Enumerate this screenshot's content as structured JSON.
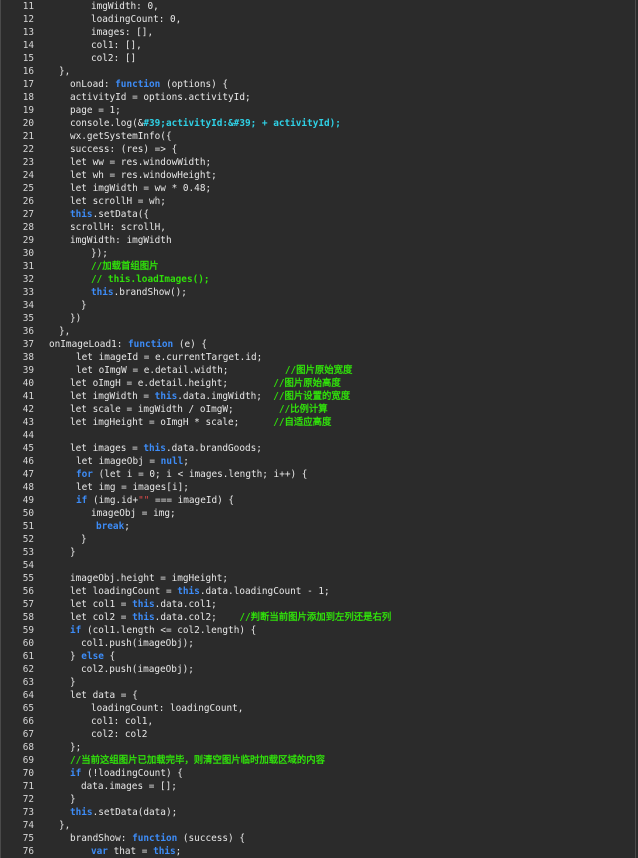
{
  "lines": [
    {
      "n": "11",
      "t": [
        [
          "imgWidth: 0,",
          ""
        ]
      ],
      "x": 90
    },
    {
      "n": "12",
      "t": [
        [
          "loadingCount: 0,",
          ""
        ]
      ],
      "x": 90
    },
    {
      "n": "13",
      "t": [
        [
          "images: [],",
          ""
        ]
      ],
      "x": 90
    },
    {
      "n": "14",
      "t": [
        [
          "col1: [],",
          ""
        ]
      ],
      "x": 90
    },
    {
      "n": "15",
      "t": [
        [
          "col2: []",
          ""
        ]
      ],
      "x": 90
    },
    {
      "n": "16",
      "t": [
        [
          "},",
          ""
        ]
      ],
      "x": 58
    },
    {
      "n": "17",
      "t": [
        [
          "onLoad: ",
          ""
        ],
        [
          "function",
          "kw"
        ],
        [
          " (options) {",
          ""
        ]
      ],
      "x": 69
    },
    {
      "n": "18",
      "t": [
        [
          "activityId = options.activityId;",
          ""
        ]
      ],
      "x": 69
    },
    {
      "n": "19",
      "t": [
        [
          "page = 1;",
          ""
        ]
      ],
      "x": 69
    },
    {
      "n": "20",
      "t": [
        [
          "console.log(&",
          ""
        ],
        [
          "#39;activityId:&#39; + activityId);",
          "lg"
        ]
      ],
      "x": 69
    },
    {
      "n": "21",
      "t": [
        [
          "wx.getSystemInfo({",
          ""
        ]
      ],
      "x": 69
    },
    {
      "n": "22",
      "t": [
        [
          "success: (res) => {",
          ""
        ]
      ],
      "x": 69
    },
    {
      "n": "23",
      "t": [
        [
          "let ww = res.windowWidth;",
          ""
        ]
      ],
      "x": 69
    },
    {
      "n": "24",
      "t": [
        [
          "let wh = res.windowHeight;",
          ""
        ]
      ],
      "x": 69
    },
    {
      "n": "25",
      "t": [
        [
          "let imgWidth = ww * 0.48;",
          ""
        ]
      ],
      "x": 69
    },
    {
      "n": "26",
      "t": [
        [
          "let scrollH = wh;",
          ""
        ]
      ],
      "x": 69
    },
    {
      "n": "27",
      "t": [
        [
          "this",
          "kw"
        ],
        [
          ".setData({",
          ""
        ]
      ],
      "x": 69
    },
    {
      "n": "28",
      "t": [
        [
          "scrollH: scrollH,",
          ""
        ]
      ],
      "x": 69
    },
    {
      "n": "29",
      "t": [
        [
          "imgWidth: imgWidth",
          ""
        ]
      ],
      "x": 69
    },
    {
      "n": "30",
      "t": [
        [
          "});",
          ""
        ]
      ],
      "x": 90
    },
    {
      "n": "31",
      "t": [
        [
          "//加载首组图片",
          "cm"
        ]
      ],
      "x": 90
    },
    {
      "n": "32",
      "t": [
        [
          "// this.loadImages();",
          "cm"
        ]
      ],
      "x": 90
    },
    {
      "n": "33",
      "t": [
        [
          "this",
          "kw"
        ],
        [
          ".brandShow();",
          ""
        ]
      ],
      "x": 90
    },
    {
      "n": "34",
      "t": [
        [
          "}",
          ""
        ]
      ],
      "x": 80
    },
    {
      "n": "35",
      "t": [
        [
          "})",
          ""
        ]
      ],
      "x": 69
    },
    {
      "n": "36",
      "t": [
        [
          "},",
          ""
        ]
      ],
      "x": 58
    },
    {
      "n": "37",
      "t": [
        [
          "onImageLoad1: ",
          ""
        ],
        [
          "function",
          "kw"
        ],
        [
          " (e) {",
          ""
        ]
      ],
      "x": 48
    },
    {
      "n": "38",
      "t": [
        [
          "let imageId = e.currentTarget.id;",
          ""
        ]
      ],
      "x": 75
    },
    {
      "n": "39",
      "t": [
        [
          "let oImgW = e.detail.width;          ",
          ""
        ],
        [
          "//图片原始宽度",
          "cm"
        ]
      ],
      "x": 75
    },
    {
      "n": "40",
      "t": [
        [
          "let oImgH = e.detail.height;        ",
          ""
        ],
        [
          "//图片原始高度",
          "cm"
        ]
      ],
      "x": 69
    },
    {
      "n": "41",
      "t": [
        [
          "let imgWidth = ",
          ""
        ],
        [
          "this",
          "kw"
        ],
        [
          ".data.imgWidth;  ",
          ""
        ],
        [
          "//图片设置的宽度",
          "cm"
        ]
      ],
      "x": 69
    },
    {
      "n": "42",
      "t": [
        [
          "let scale = imgWidth / oImgW;        ",
          ""
        ],
        [
          "//比例计算",
          "cm"
        ]
      ],
      "x": 69
    },
    {
      "n": "43",
      "t": [
        [
          "let imgHeight = oImgH * scale;      ",
          ""
        ],
        [
          "//自适应高度",
          "cm"
        ]
      ],
      "x": 69
    },
    {
      "n": "44",
      "t": [],
      "x": 69
    },
    {
      "n": "45",
      "t": [
        [
          "let images = ",
          ""
        ],
        [
          "this",
          "kw"
        ],
        [
          ".data.brandGoods;",
          ""
        ]
      ],
      "x": 69
    },
    {
      "n": "46",
      "t": [
        [
          "let imageObj = ",
          ""
        ],
        [
          "null",
          "kw"
        ],
        [
          ";",
          ""
        ]
      ],
      "x": 75
    },
    {
      "n": "47",
      "t": [
        [
          "for",
          "kw"
        ],
        [
          " (let i = 0; i < images.length; i++) {",
          ""
        ]
      ],
      "x": 75
    },
    {
      "n": "48",
      "t": [
        [
          "let img = images[i];",
          ""
        ]
      ],
      "x": 75
    },
    {
      "n": "49",
      "t": [
        [
          "if",
          "kw"
        ],
        [
          " (img.id+",
          ""
        ],
        [
          "\"\"",
          "st"
        ],
        [
          " === imageId) {",
          ""
        ]
      ],
      "x": 75
    },
    {
      "n": "50",
      "t": [
        [
          "imageObj = img;",
          ""
        ]
      ],
      "x": 90
    },
    {
      "n": "51",
      "t": [
        [
          "break",
          "kw"
        ],
        [
          ";",
          ""
        ]
      ],
      "x": 95
    },
    {
      "n": "52",
      "t": [
        [
          "}",
          ""
        ]
      ],
      "x": 80
    },
    {
      "n": "53",
      "t": [
        [
          "}",
          ""
        ]
      ],
      "x": 69
    },
    {
      "n": "54",
      "t": [],
      "x": 69
    },
    {
      "n": "55",
      "t": [
        [
          "imageObj.height = imgHeight;",
          ""
        ]
      ],
      "x": 69
    },
    {
      "n": "56",
      "t": [
        [
          "let loadingCount = ",
          ""
        ],
        [
          "this",
          "kw"
        ],
        [
          ".data.loadingCount - 1;",
          ""
        ]
      ],
      "x": 69
    },
    {
      "n": "57",
      "t": [
        [
          "let col1 = ",
          ""
        ],
        [
          "this",
          "kw"
        ],
        [
          ".data.col1;",
          ""
        ]
      ],
      "x": 69
    },
    {
      "n": "58",
      "t": [
        [
          "let col2 = ",
          ""
        ],
        [
          "this",
          "kw"
        ],
        [
          ".data.col2;    ",
          ""
        ],
        [
          "//判断当前图片添加到左列还是右列",
          "cm"
        ]
      ],
      "x": 69
    },
    {
      "n": "59",
      "t": [
        [
          "if",
          "kw"
        ],
        [
          " (col1.length <= col2.length) {",
          ""
        ]
      ],
      "x": 69
    },
    {
      "n": "60",
      "t": [
        [
          "col1.push(imageObj);",
          ""
        ]
      ],
      "x": 80
    },
    {
      "n": "61",
      "t": [
        [
          "} ",
          ""
        ],
        [
          "else",
          "kw"
        ],
        [
          " {",
          ""
        ]
      ],
      "x": 69
    },
    {
      "n": "62",
      "t": [
        [
          "col2.push(imageObj);",
          ""
        ]
      ],
      "x": 80
    },
    {
      "n": "63",
      "t": [
        [
          "}",
          ""
        ]
      ],
      "x": 69
    },
    {
      "n": "64",
      "t": [
        [
          "let data = {",
          ""
        ]
      ],
      "x": 69
    },
    {
      "n": "65",
      "t": [
        [
          "loadingCount: loadingCount,",
          ""
        ]
      ],
      "x": 90
    },
    {
      "n": "66",
      "t": [
        [
          "col1: col1,",
          ""
        ]
      ],
      "x": 90
    },
    {
      "n": "67",
      "t": [
        [
          "col2: col2",
          ""
        ]
      ],
      "x": 90
    },
    {
      "n": "68",
      "t": [
        [
          "};",
          ""
        ]
      ],
      "x": 69
    },
    {
      "n": "69",
      "t": [
        [
          "//当前这组图片已加载完毕，则清空图片临时加载区域的内容",
          "cm"
        ]
      ],
      "x": 69
    },
    {
      "n": "70",
      "t": [
        [
          "if",
          "kw"
        ],
        [
          " (!loadingCount) {",
          ""
        ]
      ],
      "x": 69
    },
    {
      "n": "71",
      "t": [
        [
          "data.images = [];",
          ""
        ]
      ],
      "x": 80
    },
    {
      "n": "72",
      "t": [
        [
          "}",
          ""
        ]
      ],
      "x": 69
    },
    {
      "n": "73",
      "t": [
        [
          "this",
          "kw"
        ],
        [
          ".setData(data);",
          ""
        ]
      ],
      "x": 69
    },
    {
      "n": "74",
      "t": [
        [
          "},",
          ""
        ]
      ],
      "x": 58
    },
    {
      "n": "75",
      "t": [
        [
          "brandShow: ",
          ""
        ],
        [
          "function",
          "kw"
        ],
        [
          " (success) {",
          ""
        ]
      ],
      "x": 69
    },
    {
      "n": "76",
      "t": [
        [
          "var",
          "kw"
        ],
        [
          " that = ",
          ""
        ],
        [
          "this",
          "kw"
        ],
        [
          ";",
          ""
        ]
      ],
      "x": 90
    }
  ]
}
